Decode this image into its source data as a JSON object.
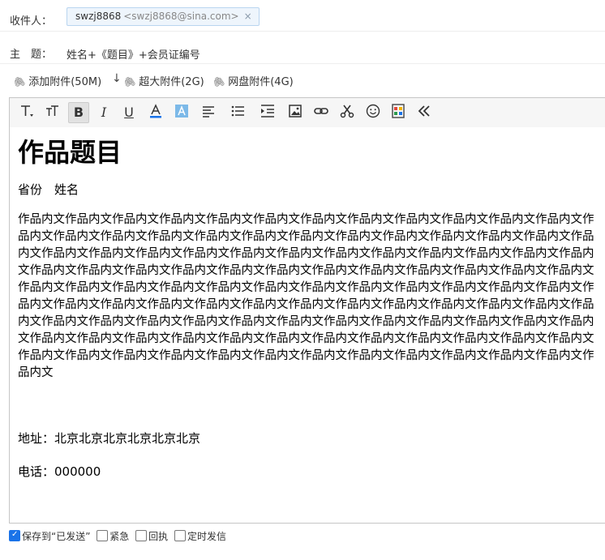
{
  "recipient": {
    "label": "收件人：",
    "chip_name": "swzj8868",
    "chip_email": "<swzj8868@sina.com>",
    "remove_glyph": "×"
  },
  "subject": {
    "label": "主　题：",
    "value": "姓名+《题目》+会员证编号"
  },
  "attachments": {
    "add": "添加附件(50M)",
    "arrow": "↓",
    "large": "超大附件(2G)",
    "disk": "网盘附件(4G)"
  },
  "toolbar": {
    "font_family_icon": "font-family-icon",
    "font_size_icon": "font-size-icon",
    "bold": "B",
    "italic": "I",
    "underline": "U",
    "text_color_icon": "text-color-icon",
    "bg_color_icon": "highlight-color-icon",
    "align_icon": "align-icon",
    "list_icon": "list-icon",
    "indent_icon": "indent-icon",
    "image_icon": "image-icon",
    "link_icon": "link-icon",
    "cut_icon": "scissors-icon",
    "emoji_icon": "emoji-icon",
    "template_icon": "template-icon",
    "collapse_icon": "double-chevron-left-icon"
  },
  "editor": {
    "heading": "作品题目",
    "author_line": "省份　姓名",
    "body": "作品内文作品内文作品内文作品内文作品内文作品内文作品内文作品内文作品内文作品内文作品内文作品内文作品内文作品内文作品内文作品内文作品内文作品内文作品内文作品内文作品内文作品内文作品内文作品内文作品内文作品内文作品内文作品内文作品内文作品内文作品内文作品内文作品内文作品内文作品内文作品内文作品内文作品内文作品内文作品内文作品内文作品内文作品内文作品内文作品内文作品内文作品内文作品内文作品内文作品内文作品内文作品内文作品内文作品内文作品内文作品内文作品内文作品内文作品内文作品内文作品内文作品内文作品内文作品内文作品内文作品内文作品内文作品内文作品内文作品内文作品内文作品内文作品内文作品内文作品内文作品内文作品内文作品内文作品内文作品内文作品内文作品内文作品内文作品内文作品内文作品内文作品内文作品内文作品内文作品内文作品内文作品内文作品内文作品内文作品内文作品内文作品内文作品内文作品内文作品内文作品内文作品内文作品内文作品内文作品内文作品内文作品内文作品内文作品内文作品内文作品内文",
    "address": "地址：北京北京北京北京北京北京",
    "phone": "电话：000000"
  },
  "options": {
    "save_sent": "保存到“已发送”",
    "save_sent_checked": true,
    "urgent": "紧急",
    "receipt": "回执",
    "scheduled": "定时发信"
  },
  "colors": {
    "chip_bg": "#eef5fc",
    "chip_border": "#b9d5f0",
    "toolbar_bg": "#f6f6f6",
    "checkbox_checked": "#1a73e8"
  }
}
